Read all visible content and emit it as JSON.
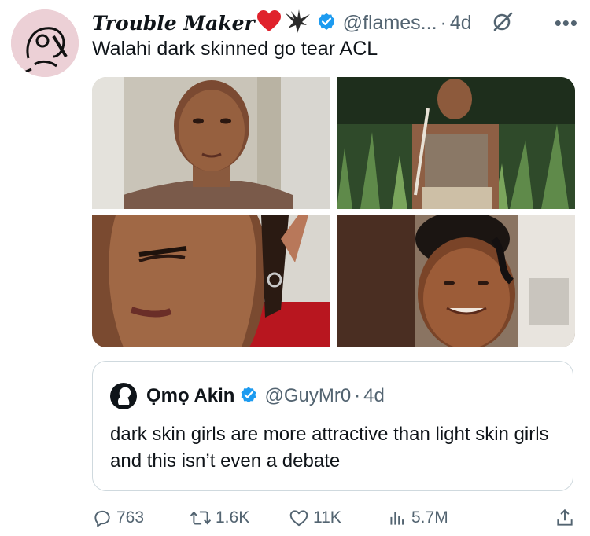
{
  "author": {
    "display_name": "Trouble Maker",
    "handle": "@flames...",
    "time": "4d",
    "separator": "·"
  },
  "tweet": {
    "text": "Walahi dark skinned go tear ACL"
  },
  "quoted": {
    "display_name": "Ọmọ Akin",
    "handle": "@GuyMr0",
    "separator": "·",
    "time": "4d",
    "text": "dark skin girls are more attractive than light skin girls and this isn’t even a debate"
  },
  "actions": {
    "replies": "763",
    "reposts": "1.6K",
    "likes": "11K",
    "views": "5.7M"
  },
  "icons": {
    "more": "more-icon",
    "grok": "grok-icon",
    "verified": "verified-badge-icon",
    "reply": "reply-icon",
    "repost": "repost-icon",
    "like": "heart-icon",
    "views": "views-icon",
    "share": "share-icon"
  },
  "colors": {
    "verified": "#1d9bf0",
    "secondary_text": "#536471",
    "primary_text": "#0f1419",
    "border": "#cfd9de"
  }
}
